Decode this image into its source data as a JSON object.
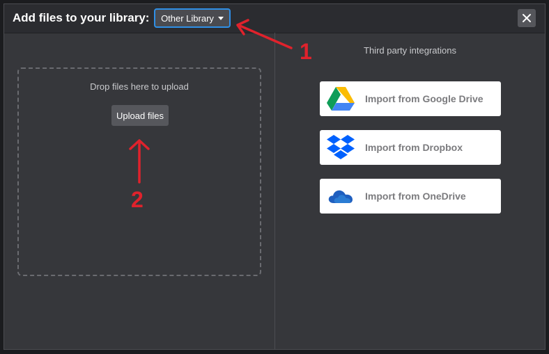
{
  "header": {
    "title": "Add files to your library:",
    "library_dropdown": "Other Library",
    "close_icon": "close-icon"
  },
  "left": {
    "drop_text": "Drop files here to upload",
    "upload_label": "Upload files"
  },
  "right": {
    "title": "Third party integrations",
    "imports": [
      {
        "label": "Import from Google Drive",
        "icon": "google-drive-icon"
      },
      {
        "label": "Import from Dropbox",
        "icon": "dropbox-icon"
      },
      {
        "label": "Import from OneDrive",
        "icon": "onedrive-icon"
      }
    ]
  },
  "annotations": {
    "marker_1": "1",
    "marker_2": "2",
    "color": "#e0222c"
  },
  "colors": {
    "accent": "#2f8fe6",
    "modal_bg": "#36373b",
    "header_bg": "#2b2c30"
  }
}
